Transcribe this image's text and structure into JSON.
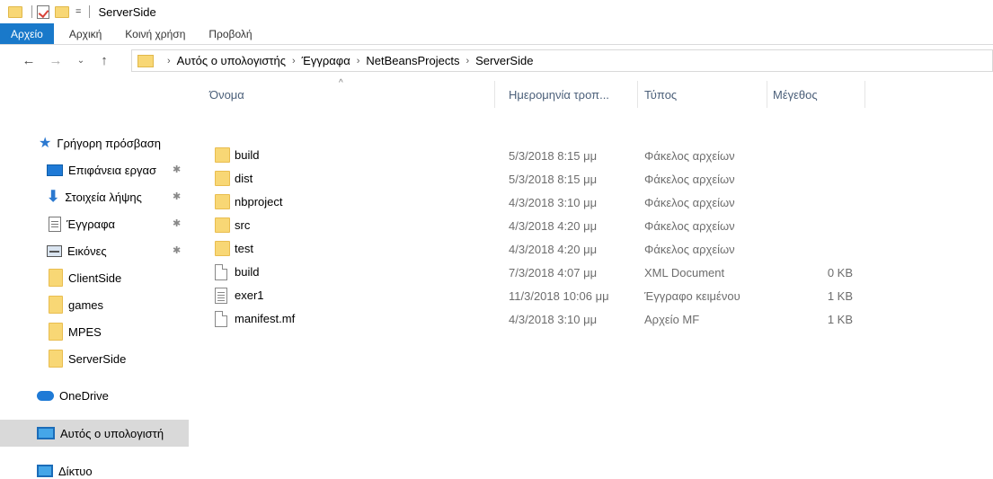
{
  "window": {
    "title": "ServerSide",
    "quick_access": {
      "icons": [
        "folder-icon",
        "properties-check-icon",
        "new-folder-icon"
      ],
      "dropdown_glyph": "="
    }
  },
  "ribbon": {
    "tabs": [
      "Αρχείο",
      "Αρχική",
      "Κοινή χρήση",
      "Προβολή"
    ],
    "accent": "#1979ca"
  },
  "navigation": {
    "back_glyph": "←",
    "forward_glyph": "→",
    "recent_glyph": "⌄",
    "up_glyph": "↑",
    "breadcrumb": [
      "Αυτός ο υπολογιστής",
      "Έγγραφα",
      "NetBeansProjects",
      "ServerSide"
    ]
  },
  "sidebar": {
    "items": [
      {
        "label": "Γρήγορη πρόσβαση",
        "icon": "star-icon",
        "pinned": false
      },
      {
        "label": "Επιφάνεια εργασ",
        "icon": "desktop-icon",
        "pinned": true
      },
      {
        "label": "Στοιχεία λήψης",
        "icon": "download-icon",
        "pinned": true
      },
      {
        "label": "Έγγραφα",
        "icon": "document-icon",
        "pinned": true
      },
      {
        "label": "Εικόνες",
        "icon": "pictures-icon",
        "pinned": true
      },
      {
        "label": "ClientSide",
        "icon": "folder-icon",
        "pinned": false
      },
      {
        "label": "games",
        "icon": "folder-icon",
        "pinned": false
      },
      {
        "label": "MPES",
        "icon": "folder-icon",
        "pinned": false
      },
      {
        "label": "ServerSide",
        "icon": "folder-icon",
        "pinned": false
      },
      {
        "label": "OneDrive",
        "icon": "onedrive-icon",
        "pinned": false
      },
      {
        "label": "Αυτός ο υπολογιστή",
        "icon": "computer-icon",
        "pinned": false,
        "selected": true
      },
      {
        "label": "Δίκτυο",
        "icon": "network-icon",
        "pinned": false
      }
    ],
    "pin_glyph": "✱"
  },
  "columns": {
    "name": "Όνομα",
    "date": "Ημερομηνία τροπ...",
    "type": "Τύπος",
    "size": "Μέγεθος",
    "sort_glyph": "^"
  },
  "files": [
    {
      "name": "build",
      "date": "5/3/2018 8:15 μμ",
      "type": "Φάκελος αρχείων",
      "size": "",
      "icon": "folder-icon"
    },
    {
      "name": "dist",
      "date": "5/3/2018 8:15 μμ",
      "type": "Φάκελος αρχείων",
      "size": "",
      "icon": "folder-icon"
    },
    {
      "name": "nbproject",
      "date": "4/3/2018 3:10 μμ",
      "type": "Φάκελος αρχείων",
      "size": "",
      "icon": "folder-icon"
    },
    {
      "name": "src",
      "date": "4/3/2018 4:20 μμ",
      "type": "Φάκελος αρχείων",
      "size": "",
      "icon": "folder-icon"
    },
    {
      "name": "test",
      "date": "4/3/2018 4:20 μμ",
      "type": "Φάκελος αρχείων",
      "size": "",
      "icon": "folder-icon"
    },
    {
      "name": "build",
      "date": "7/3/2018 4:07 μμ",
      "type": "XML Document",
      "size": "0 KB",
      "icon": "file-icon"
    },
    {
      "name": "exer1",
      "date": "11/3/2018 10:06 μμ",
      "type": "Έγγραφο κειμένου",
      "size": "1 KB",
      "icon": "text-file-icon"
    },
    {
      "name": "manifest.mf",
      "date": "4/3/2018 3:10 μμ",
      "type": "Αρχείο MF",
      "size": "1 KB",
      "icon": "file-icon"
    }
  ]
}
